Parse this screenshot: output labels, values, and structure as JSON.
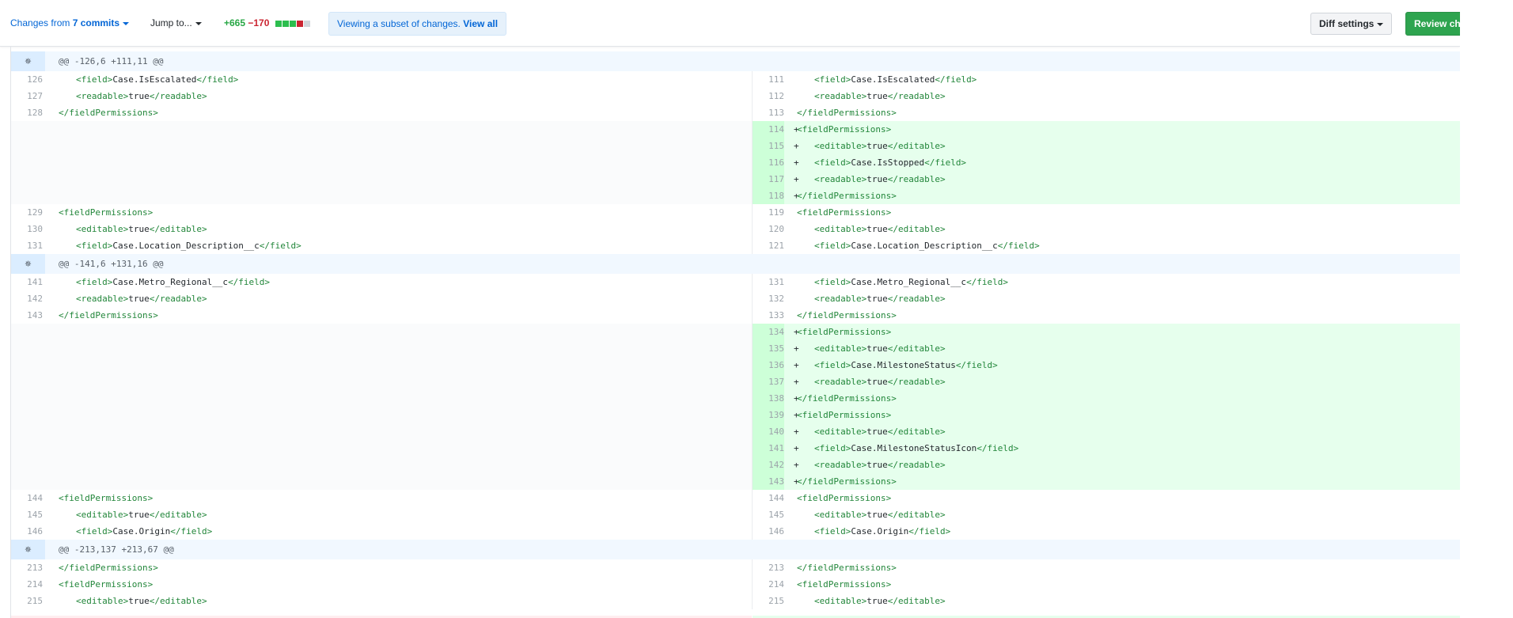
{
  "toolbar": {
    "changes_prefix": "Changes from ",
    "commits_link": "7 commits",
    "jump_to": "Jump to...",
    "additions": "+665",
    "deletions": "−170",
    "notice_text": "Viewing a subset of changes.",
    "notice_link": "View all",
    "diff_settings": "Diff settings",
    "review_button": "Review changes"
  },
  "hunks": [
    {
      "header": "@@ -126,6 +111,11 @@",
      "rows": [
        {
          "l": "126",
          "r": "111",
          "open": "<field>",
          "text": "Case.IsEscalated",
          "close": "</field>",
          "indent": 2
        },
        {
          "l": "127",
          "r": "112",
          "open": "<readable>",
          "text": "true",
          "close": "</readable>",
          "indent": 2
        },
        {
          "l": "128",
          "r": "113",
          "open": "",
          "text": "",
          "close": "</fieldPermissions>",
          "indent": 1
        },
        {
          "r": "114",
          "open": "<fieldPermissions>",
          "text": "",
          "close": "",
          "indent": 1,
          "add": true
        },
        {
          "r": "115",
          "open": "<editable>",
          "text": "true",
          "close": "</editable>",
          "indent": 2,
          "add": true
        },
        {
          "r": "116",
          "open": "<field>",
          "text": "Case.IsStopped",
          "close": "</field>",
          "indent": 2,
          "add": true
        },
        {
          "r": "117",
          "open": "<readable>",
          "text": "true",
          "close": "</readable>",
          "indent": 2,
          "add": true
        },
        {
          "r": "118",
          "open": "",
          "text": "",
          "close": "</fieldPermissions>",
          "indent": 1,
          "add": true
        },
        {
          "l": "129",
          "r": "119",
          "open": "<fieldPermissions>",
          "text": "",
          "close": "",
          "indent": 1
        },
        {
          "l": "130",
          "r": "120",
          "open": "<editable>",
          "text": "true",
          "close": "</editable>",
          "indent": 2
        },
        {
          "l": "131",
          "r": "121",
          "open": "<field>",
          "text": "Case.Location_Description__c",
          "close": "</field>",
          "indent": 2
        }
      ]
    },
    {
      "header": "@@ -141,6 +131,16 @@",
      "rows": [
        {
          "l": "141",
          "r": "131",
          "open": "<field>",
          "text": "Case.Metro_Regional__c",
          "close": "</field>",
          "indent": 2
        },
        {
          "l": "142",
          "r": "132",
          "open": "<readable>",
          "text": "true",
          "close": "</readable>",
          "indent": 2
        },
        {
          "l": "143",
          "r": "133",
          "open": "",
          "text": "",
          "close": "</fieldPermissions>",
          "indent": 1
        },
        {
          "r": "134",
          "open": "<fieldPermissions>",
          "text": "",
          "close": "",
          "indent": 1,
          "add": true
        },
        {
          "r": "135",
          "open": "<editable>",
          "text": "true",
          "close": "</editable>",
          "indent": 2,
          "add": true
        },
        {
          "r": "136",
          "open": "<field>",
          "text": "Case.MilestoneStatus",
          "close": "</field>",
          "indent": 2,
          "add": true
        },
        {
          "r": "137",
          "open": "<readable>",
          "text": "true",
          "close": "</readable>",
          "indent": 2,
          "add": true
        },
        {
          "r": "138",
          "open": "",
          "text": "",
          "close": "</fieldPermissions>",
          "indent": 1,
          "add": true
        },
        {
          "r": "139",
          "open": "<fieldPermissions>",
          "text": "",
          "close": "",
          "indent": 1,
          "add": true
        },
        {
          "r": "140",
          "open": "<editable>",
          "text": "true",
          "close": "</editable>",
          "indent": 2,
          "add": true
        },
        {
          "r": "141",
          "open": "<field>",
          "text": "Case.MilestoneStatusIcon",
          "close": "</field>",
          "indent": 2,
          "add": true
        },
        {
          "r": "142",
          "open": "<readable>",
          "text": "true",
          "close": "</readable>",
          "indent": 2,
          "add": true
        },
        {
          "r": "143",
          "open": "",
          "text": "",
          "close": "</fieldPermissions>",
          "indent": 1,
          "add": true
        },
        {
          "l": "144",
          "r": "144",
          "open": "<fieldPermissions>",
          "text": "",
          "close": "",
          "indent": 1
        },
        {
          "l": "145",
          "r": "145",
          "open": "<editable>",
          "text": "true",
          "close": "</editable>",
          "indent": 2
        },
        {
          "l": "146",
          "r": "146",
          "open": "<field>",
          "text": "Case.Origin",
          "close": "</field>",
          "indent": 2
        }
      ]
    },
    {
      "header": "@@ -213,137 +213,67 @@",
      "rows": [
        {
          "l": "213",
          "r": "213",
          "open": "",
          "text": "",
          "close": "</fieldPermissions>",
          "indent": 1
        },
        {
          "l": "214",
          "r": "214",
          "open": "<fieldPermissions>",
          "text": "",
          "close": "",
          "indent": 1
        },
        {
          "l": "215",
          "r": "215",
          "open": "<editable>",
          "text": "true",
          "close": "</editable>",
          "indent": 2
        }
      ]
    }
  ],
  "add_marker": "+",
  "icons": {
    "expand": "expand-icon",
    "caret": "caret-down-icon"
  },
  "colors": {
    "added_bg": "#e6ffed",
    "added_num_bg": "#cdffd8",
    "hunk_bg": "#f1f8ff",
    "review_green": "#2ea44f"
  }
}
